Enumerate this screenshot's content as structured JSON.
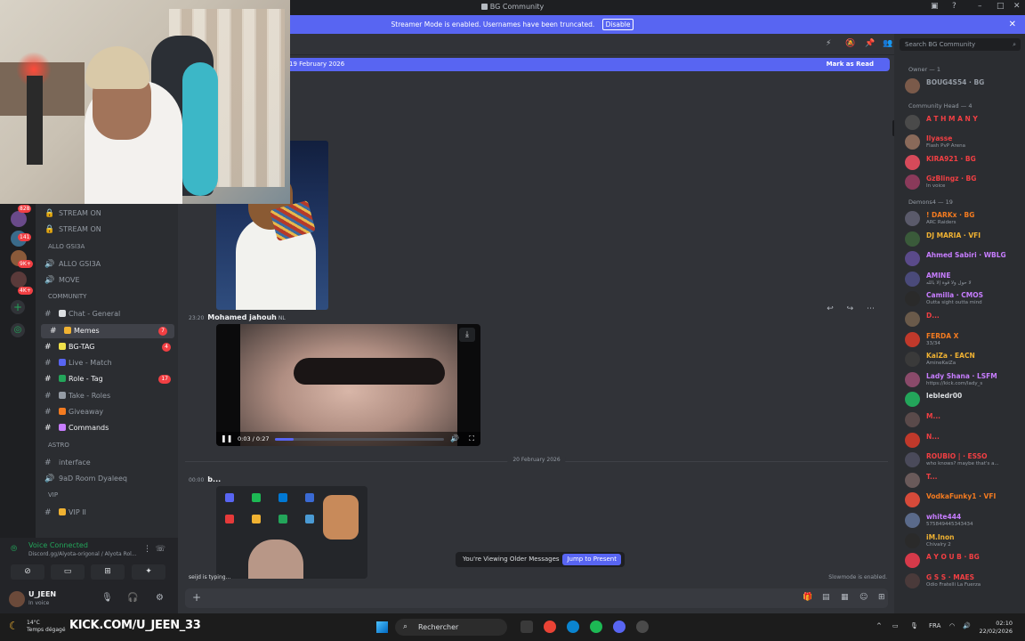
{
  "window": {
    "title": "BG Community"
  },
  "banner": {
    "text": "Streamer Mode is enabled. Usernames have been truncated.",
    "disable": "Disable"
  },
  "rail_badges": [
    "828",
    "141",
    "9K+",
    "4K+"
  ],
  "channels": [
    {
      "type": "stage",
      "label": "STREAM ON",
      "muted": true
    },
    {
      "type": "stage",
      "label": "STREAM ON",
      "muted": true
    },
    {
      "type": "category",
      "label": "ALLO GSI3A"
    },
    {
      "type": "voice",
      "label": "ALLO GSI3A"
    },
    {
      "type": "voice",
      "label": "MOVE"
    },
    {
      "type": "category",
      "label": "COMMUNITY"
    },
    {
      "type": "text",
      "label": "Chat - General",
      "emoji": "#dbdee1"
    },
    {
      "type": "text",
      "label": "Memes",
      "emoji": "#f0b232",
      "active": true,
      "count": "7"
    },
    {
      "type": "text",
      "label": "BG-TAG",
      "emoji": "#f0e14a",
      "bold": true,
      "count": "4"
    },
    {
      "type": "text",
      "label": "Live - Match",
      "emoji": "#5865f2"
    },
    {
      "type": "text",
      "label": "Role - Tag",
      "emoji": "#23a55a",
      "bold": true,
      "count": "17"
    },
    {
      "type": "text",
      "label": "Take - Roles",
      "emoji": "#949ba4"
    },
    {
      "type": "text",
      "label": "Giveaway",
      "emoji": "#f47b20"
    },
    {
      "type": "text",
      "label": "Commands",
      "emoji": "#c77dff",
      "bold": true
    },
    {
      "type": "category",
      "label": "Astro"
    },
    {
      "type": "text",
      "label": "interface"
    },
    {
      "type": "voice",
      "label": "9aD Room Dyaleeq"
    },
    {
      "type": "category",
      "label": "VIP"
    },
    {
      "type": "text",
      "label": "VIP II",
      "emoji": "#f0b232"
    }
  ],
  "voice_panel": {
    "status": "Voice Connected",
    "server": "Discord.gg/Alyota-origonal / Alyota Rol..."
  },
  "user": {
    "name": "U_JEEN",
    "status": "In voice"
  },
  "chat": {
    "new_messages_date": "19 February 2026",
    "mark_as_read": "Mark as Read",
    "message": {
      "time": "23:20",
      "author": "Mohamed jahouh",
      "tag": "NL"
    },
    "video": {
      "time": "0:03 / 0:27",
      "progress": 0.11
    },
    "divider_date": "20 February 2026",
    "message2": {
      "time": "00:00",
      "author": "b..."
    },
    "older_text": "You're Viewing Older Messages",
    "jump_label": "Jump to Present",
    "typing": "seijd is typing...",
    "slowmode": "Slowmode is enabled."
  },
  "members": {
    "search_placeholder": "Search BG Community",
    "groups": [
      {
        "label": "Owner — 1"
      },
      {
        "label": "Community Head — 4"
      },
      {
        "label": "Demons4 — 19"
      }
    ],
    "list": [
      {
        "name": "BOUG4S54 · BG",
        "color": "#949ba4",
        "avatar": "#7a5a4a"
      },
      {
        "name": "A T H M A N Y",
        "color": "#f23f43",
        "avatar": "#4a4a4a"
      },
      {
        "name": "Ilyasse",
        "color": "#f23f43",
        "sub": "Flash PvP Arena",
        "avatar": "#8a6a5a"
      },
      {
        "name": "KIRA921 · BG",
        "color": "#f23f43",
        "avatar": "#d64a5a"
      },
      {
        "name": "GzBlingz · BG",
        "color": "#f23f43",
        "sub": "In voice",
        "avatar": "#8a3a5a"
      },
      {
        "name": "! DARKx · BG",
        "color": "#f47b20",
        "sub": "ARC Raiders",
        "avatar": "#5a5a6a"
      },
      {
        "name": "DJ MARIA · VFI",
        "color": "#f0b232",
        "avatar": "#3a5a3a"
      },
      {
        "name": "Ahmed Sabiri · WBLG",
        "color": "#c77dff",
        "avatar": "#5a4a8a"
      },
      {
        "name": "AMINE",
        "color": "#c77dff",
        "sub": "لا حول ولا قوة إلا بالله",
        "avatar": "#4a4a7a"
      },
      {
        "name": "Camilla · CMOS",
        "color": "#c77dff",
        "sub": "Outta sight outta mind",
        "avatar": "#2a2a2a"
      },
      {
        "name": "D...",
        "color": "#f23f43",
        "avatar": "#6a5a4a"
      },
      {
        "name": "FERDA X",
        "color": "#f47b20",
        "sub": "33/34",
        "avatar": "#c0392b"
      },
      {
        "name": "KaiZa · EACN",
        "color": "#f0b232",
        "sub": "AmineKaiZa",
        "avatar": "#3a3a3a"
      },
      {
        "name": "Lady Shana · LSFM",
        "color": "#c77dff",
        "sub": "https://kick.com/lady_s",
        "avatar": "#8a4a6a"
      },
      {
        "name": "lebledr00",
        "color": "#dbdee1",
        "avatar": "#23a55a"
      },
      {
        "name": "M...",
        "color": "#f23f43",
        "avatar": "#5a4a4a"
      },
      {
        "name": "N...",
        "color": "#f23f43",
        "avatar": "#c0392b"
      },
      {
        "name": "ROUBIO | · ESSO",
        "color": "#f23f43",
        "sub": "who knows? maybe that's a...",
        "avatar": "#4a4a5a"
      },
      {
        "name": "T...",
        "color": "#f23f43",
        "avatar": "#6a5a5a"
      },
      {
        "name": "VodkaFunky1 · VFI",
        "color": "#f47b20",
        "avatar": "#d64a3a"
      },
      {
        "name": "white444",
        "color": "#c77dff",
        "sub": "575849445343434",
        "avatar": "#5a6a8a"
      },
      {
        "name": "iM.Inon",
        "color": "#f0b232",
        "sub": "Chivalry 2",
        "avatar": "#2a2a2a"
      },
      {
        "name": "A Y O U B · BG",
        "color": "#f23f43",
        "avatar": "#d63a4a"
      },
      {
        "name": "G S S · MAES",
        "color": "#f23f43",
        "sub": "Odio Fratelli La Fuerza",
        "avatar": "#4a3a3a"
      }
    ]
  },
  "taskbar": {
    "weather_temp": "14°C",
    "weather_desc": "Temps dégagé",
    "overlay": "KICK.COM/U_JEEN_33",
    "search": "Rechercher",
    "lang": "FRA",
    "time": "02:10",
    "date": "22/02/2026"
  }
}
